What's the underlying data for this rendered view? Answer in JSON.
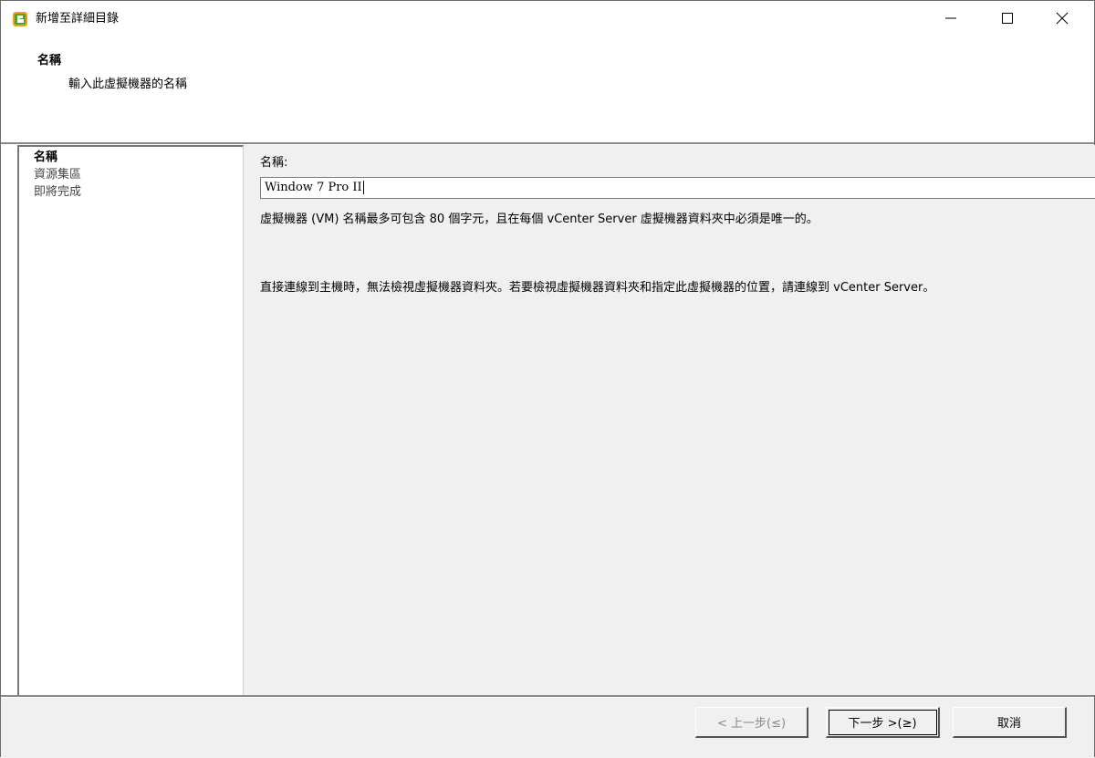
{
  "window": {
    "title": "新增至詳細目錄",
    "controls": {
      "minimize": "—",
      "maximize": "☐",
      "close": "✕"
    }
  },
  "header": {
    "title": "名稱",
    "subtitle": "輸入此虛擬機器的名稱"
  },
  "nav": {
    "items": [
      {
        "label": "名稱",
        "active": true
      },
      {
        "label": "資源集區",
        "active": false
      },
      {
        "label": "即將完成",
        "active": false
      }
    ]
  },
  "form": {
    "name_label": "名稱:",
    "name_value": "Window 7 Pro II",
    "info_limit": "虛擬機器 (VM) 名稱最多可包含 80 個字元，且在每個 vCenter Server 虛擬機器資料夾中必須是唯一的。",
    "info_host": "直接連線到主機時，無法檢視虛擬機器資料夾。若要檢視虛擬機器資料夾和指定此虛擬機器的位置，請連線到 vCenter Server。"
  },
  "footer": {
    "back_label": "< 上一步(≤)",
    "next_label": "下一步 >(≥)",
    "cancel_label": "取消"
  },
  "colors": {
    "content_bg": "#f0f0f0",
    "nav_bg": "#ffffff",
    "icon_green": "#5a9e2f",
    "icon_orange": "#f0a020"
  },
  "icons": {
    "app": "vsphere-app-icon"
  }
}
